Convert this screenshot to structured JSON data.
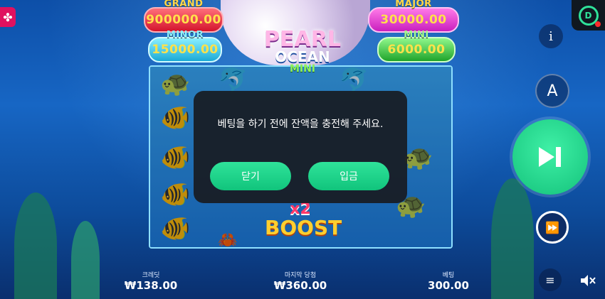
{
  "jackpots": {
    "grand": {
      "label": "GRAND",
      "value": "900000.00"
    },
    "major": {
      "label": "MAJOR",
      "value": "30000.00"
    },
    "minor": {
      "label": "MINOR",
      "value": "15000.00"
    },
    "mini": {
      "label": "MINI",
      "value": "6000.00"
    }
  },
  "logo": {
    "line1": "PEARL",
    "line2": "OCEAN",
    "line3": "MINI"
  },
  "boost": {
    "multiplier": "x2",
    "label": "BOOST"
  },
  "dialog": {
    "message": "베팅을 하기 전에 잔액을 충전해 주세요.",
    "close_label": "닫기",
    "deposit_label": "입금"
  },
  "controls": {
    "info_symbol": "i",
    "auto_symbol": "A",
    "icons": {
      "menu": "clover-icon",
      "brand": "provider-logo-icon",
      "spin": "play-skip-icon",
      "turbo": "fast-forward-icon",
      "stack": "coin-stack-icon",
      "sound": "speaker-muted-icon"
    }
  },
  "stats": {
    "credit": {
      "label": "크레딧",
      "value": "₩138.00"
    },
    "last_win": {
      "label": "마지막 당첨",
      "value": "₩360.00"
    },
    "bet": {
      "label": "베팅",
      "value": "300.00"
    }
  },
  "colors": {
    "accent": "#2fe39a",
    "dialog_bg": "#181c22"
  }
}
